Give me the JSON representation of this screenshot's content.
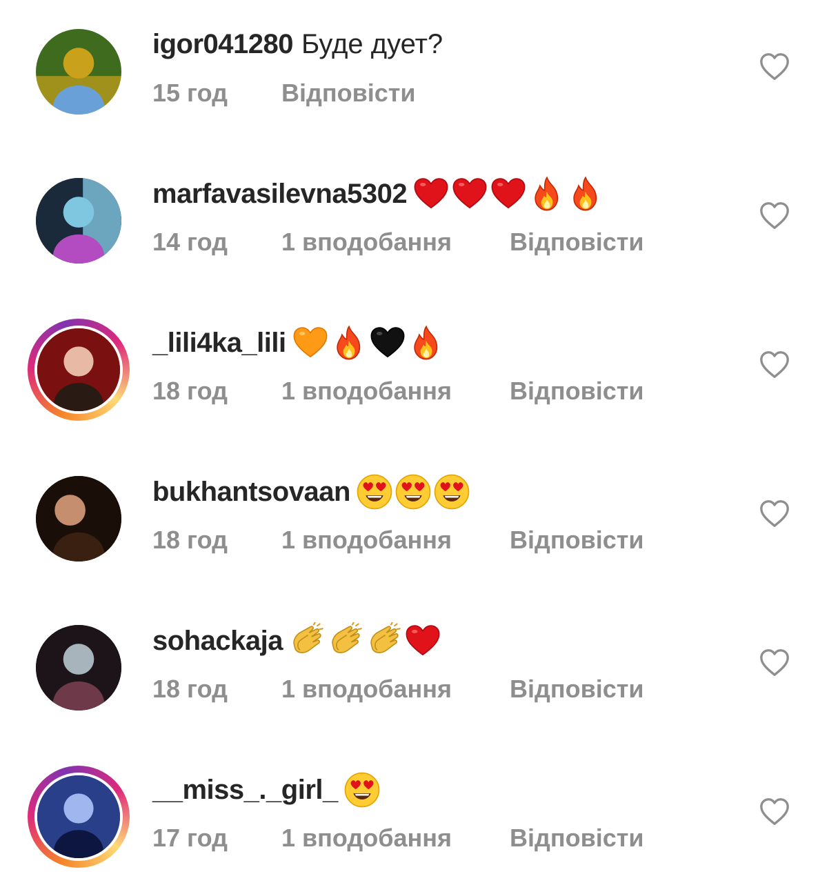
{
  "comments": [
    {
      "username": "igor041280",
      "text": "Буде дует?",
      "emojis": [],
      "time": "15 год",
      "likes": "",
      "reply": "Відповісти",
      "story_ring": false,
      "avatar_colors": [
        "#3f6b1f",
        "#c9a11b",
        "#6aa0d8"
      ]
    },
    {
      "username": "marfavasilevna5302",
      "text": "",
      "emojis": [
        "red-heart",
        "red-heart",
        "red-heart",
        "fire",
        "fire"
      ],
      "time": "14 год",
      "likes": "1 вподобання",
      "reply": "Відповісти",
      "story_ring": false,
      "avatar_colors": [
        "#1b2a3a",
        "#7fc6e0",
        "#b24cc0"
      ]
    },
    {
      "username": "_lili4ka_lili",
      "text": "",
      "emojis": [
        "orange-heart",
        "fire",
        "black-heart",
        "fire"
      ],
      "time": "18 год",
      "likes": "1 вподобання",
      "reply": "Відповісти",
      "story_ring": true,
      "avatar_colors": [
        "#7a1010",
        "#e8b9a4",
        "#2a1a14"
      ]
    },
    {
      "username": "bukhantsovaan",
      "text": "",
      "emojis": [
        "heart-eyes",
        "heart-eyes",
        "heart-eyes"
      ],
      "time": "18 год",
      "likes": "1 вподобання",
      "reply": "Відповісти",
      "story_ring": false,
      "avatar_colors": [
        "#1a0f08",
        "#c58f6f",
        "#3a2010"
      ]
    },
    {
      "username": "sohackaja",
      "text": "",
      "emojis": [
        "clapping",
        "clapping",
        "clapping",
        "red-heart"
      ],
      "time": "18 год",
      "likes": "1 вподобання",
      "reply": "Відповісти",
      "story_ring": false,
      "avatar_colors": [
        "#1c1418",
        "#a8b4bc",
        "#6e3a4a"
      ]
    },
    {
      "username": "__miss_._girl_",
      "text": "",
      "emojis": [
        "heart-eyes"
      ],
      "time": "17 год",
      "likes": "1 вподобання",
      "reply": "Відповісти",
      "story_ring": true,
      "avatar_colors": [
        "#2a3f8a",
        "#9fb6ee",
        "#0d1640"
      ]
    }
  ],
  "icons": {
    "like": "heart-outline-icon"
  }
}
